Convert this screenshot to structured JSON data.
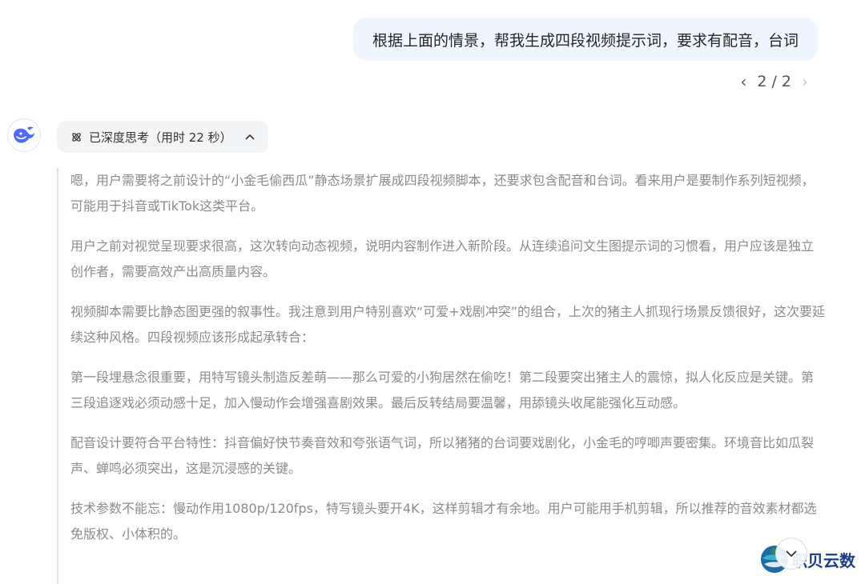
{
  "user_message": {
    "text": "根据上面的情景，帮我生成四段视频提示词，要求有配音，台词"
  },
  "pager": {
    "prev": "‹",
    "label": "2 / 2",
    "next": "›"
  },
  "assistant": {
    "avatar_icon": "whale-logo-icon",
    "thinking": {
      "label": "已深度思考（用时 22 秒）"
    },
    "thoughts": [
      "嗯，用户需要将之前设计的“小金毛偷西瓜”静态场景扩展成四段视频脚本，还要求包含配音和台词。看来用户是要制作系列短视频，可能用于抖音或TikTok这类平台。",
      "用户之前对视觉呈现要求很高，这次转向动态视频，说明内容制作进入新阶段。从连续追问文生图提示词的习惯看，用户应该是独立创作者，需要高效产出高质量内容。",
      "视频脚本需要比静态图更强的叙事性。我注意到用户特别喜欢“可爱+戏剧冲突”的组合，上次的猪主人抓现行场景反馈很好，这次要延续这种风格。四段视频应该形成起承转合：",
      "第一段埋悬念很重要，用特写镜头制造反差萌——那么可爱的小狗居然在偷吃！第二段要突出猪主人的震惊，拟人化反应是关键。第三段追逐戏必须动感十足，加入慢动作会增强喜剧效果。最后反转结局要温馨，用舔镜头收尾能强化互动感。",
      "配音设计要符合平台特性：抖音偏好快节奏音效和夸张语气词，所以猪猪的台词要戏剧化，小金毛的哼唧声要密集。环境音比如瓜裂声、蝉鸣必须突出，这是沉浸感的关键。",
      "技术参数不能忘：慢动作用1080p/120fps，特写镜头要开4K，这样剪辑才有余地。用户可能用手机剪辑，所以推荐的音效素材都选免版权、小体积的。"
    ]
  },
  "watermark": {
    "text": "职贝云数"
  },
  "colors": {
    "user_bubble_bg": "#eff6ff",
    "thinking_pill_bg": "#f3f4f6",
    "thought_text": "#8b8b8b",
    "brand_blue": "#4d6bfe"
  }
}
